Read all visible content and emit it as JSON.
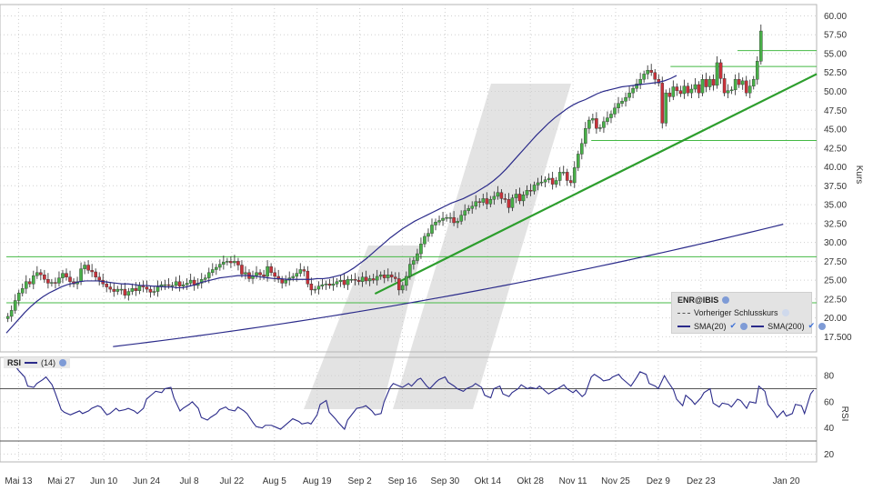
{
  "chart_data": [
    {
      "type": "candlestick",
      "ylabel": "Kurs",
      "ylim": [
        15.5,
        61.5
      ],
      "y_ticks": [
        "60.00",
        "57.50",
        "55.00",
        "52.50",
        "50.00",
        "47.50",
        "45.00",
        "42.50",
        "40.00",
        "37.50",
        "35.00",
        "32.50",
        "30.00",
        "27.50",
        "25.00",
        "22.50",
        "20.00",
        "17.500"
      ],
      "y_tick_values": [
        60,
        57.5,
        55,
        52.5,
        50,
        47.5,
        45,
        42.5,
        40,
        37.5,
        35,
        32.5,
        30,
        27.5,
        25,
        22.5,
        20,
        17.5
      ],
      "x_ticks": [
        "Mai 13",
        "Mai 27",
        "Jun 10",
        "Jun 24",
        "Jul 8",
        "Jul 22",
        "Aug 5",
        "Aug 19",
        "Sep 2",
        "Sep 16",
        "Sep 30",
        "Okt 14",
        "Okt 28",
        "Nov 11",
        "Nov 25",
        "Dez 9",
        "Dez 23",
        "Jan 20"
      ],
      "x_tick_days": [
        4,
        18,
        32,
        46,
        60,
        74,
        88,
        102,
        116,
        130,
        144,
        158,
        172,
        186,
        200,
        214,
        228,
        256
      ],
      "close": [
        20.2,
        21.0,
        22.3,
        23.3,
        23.9,
        24.8,
        24.5,
        25.6,
        26.0,
        25.7,
        25.1,
        24.6,
        24.7,
        24.6,
        25.3,
        25.9,
        25.4,
        24.8,
        24.5,
        24.8,
        26.5,
        27.0,
        26.3,
        26.1,
        25.4,
        25.0,
        24.5,
        24.1,
        23.8,
        23.5,
        23.8,
        23.8,
        23.0,
        23.5,
        23.9,
        23.6,
        24.3,
        24.1,
        23.8,
        23.4,
        23.5,
        24.1,
        24.4,
        24.4,
        24.3,
        24.3,
        24.8,
        24.2,
        24.4,
        24.6,
        25.0,
        24.3,
        24.6,
        25.1,
        25.3,
        26.0,
        26.4,
        26.7,
        27.1,
        27.4,
        27.5,
        27.3,
        27.5,
        27.0,
        25.8,
        26.0,
        25.2,
        25.6,
        26.0,
        25.7,
        25.5,
        26.8,
        26.0,
        25.5,
        25.1,
        24.6,
        25.0,
        25.3,
        25.5,
        25.9,
        26.4,
        26.2,
        24.5,
        23.7,
        23.8,
        24.2,
        24.4,
        24.5,
        24.3,
        24.5,
        24.8,
        25.0,
        24.4,
        25.1,
        25.1,
        25.0,
        24.8,
        25.4,
        24.9,
        25.2,
        25.0,
        25.5,
        25.7,
        25.3,
        25.7,
        25.4,
        25.2,
        23.7,
        24.3,
        25.5,
        27.1,
        27.6,
        28.5,
        29.8,
        30.8,
        31.2,
        32.3,
        32.7,
        32.9,
        33.2,
        33.3,
        33.3,
        32.6,
        32.8,
        33.6,
        34.2,
        34.5,
        34.8,
        35.4,
        35.3,
        35.8,
        35.1,
        35.7,
        36.1,
        36.6,
        35.8,
        35.7,
        34.6,
        35.9,
        36.4,
        35.5,
        36.3,
        36.9,
        36.8,
        37.6,
        37.9,
        38.0,
        38.3,
        38.5,
        37.7,
        38.2,
        39.3,
        39.3,
        38.2,
        37.9,
        39.9,
        41.7,
        43.1,
        45.1,
        46.2,
        46.4,
        45.1,
        45.2,
        46.0,
        46.5,
        47.0,
        47.8,
        48.4,
        48.7,
        49.2,
        49.8,
        50.4,
        51.0,
        51.6,
        52.3,
        52.8,
        52.5,
        51.6,
        51.1,
        45.8,
        49.8,
        49.3,
        50.6,
        50.1,
        49.7,
        50.7,
        49.8,
        50.3,
        50.9,
        49.8,
        51.6,
        50.6,
        51.6,
        50.8,
        53.8,
        51.7,
        49.8,
        50.1,
        50.2,
        51.6,
        50.9,
        51.4,
        49.8,
        50.7,
        51.6,
        54.0,
        58.0
      ],
      "sma20": [
        18.0,
        18.9,
        19.8,
        20.7,
        21.5,
        22.2,
        22.8,
        23.3,
        23.7,
        24.1,
        24.4,
        24.6,
        24.8,
        24.9,
        24.9,
        24.9,
        24.8,
        24.7,
        24.6,
        24.5,
        24.5,
        24.4,
        24.3,
        24.3,
        24.2,
        24.2,
        24.1,
        24.1,
        24.0,
        24.0,
        24.2,
        24.4,
        24.7,
        24.9,
        25.1,
        25.3,
        25.4,
        25.5,
        25.6,
        25.6,
        25.6,
        25.5,
        25.4,
        25.3,
        25.2,
        25.2,
        25.1,
        25.1,
        25.1,
        25.1,
        25.1,
        25.2,
        25.2,
        25.3,
        25.5,
        25.7,
        26.1,
        26.6,
        27.2,
        27.8,
        28.5,
        29.2,
        29.9,
        30.6,
        31.2,
        31.8,
        32.3,
        32.8,
        33.2,
        33.6,
        34.0,
        34.4,
        34.8,
        35.2,
        35.5,
        35.8,
        36.2,
        36.6,
        37.1,
        37.6,
        38.2,
        38.9,
        39.7,
        40.6,
        41.5,
        42.4,
        43.3,
        44.2,
        45.0,
        45.8,
        46.5,
        47.1,
        47.7,
        48.2,
        48.6,
        48.9,
        49.3,
        49.7,
        50.0,
        50.2,
        50.4,
        50.6,
        50.7,
        50.8,
        50.9,
        51.0,
        51.1,
        51.2,
        51.4,
        51.7,
        52.1
      ],
      "sma20_days": [
        0,
        2,
        4,
        6,
        8,
        10,
        12,
        14,
        16,
        18,
        20,
        22,
        24,
        26,
        28,
        30,
        32,
        34,
        36,
        38,
        40,
        42,
        44,
        46,
        48,
        50,
        52,
        54,
        56,
        58,
        60,
        62,
        64,
        66,
        68,
        70,
        72,
        74,
        76,
        78,
        80,
        82,
        84,
        86,
        88,
        90,
        92,
        94,
        96,
        98,
        100,
        102,
        104,
        106,
        108,
        110,
        112,
        114,
        116,
        118,
        120,
        122,
        124,
        126,
        128,
        130,
        132,
        134,
        136,
        138,
        140,
        142,
        144,
        146,
        148,
        150,
        152,
        154,
        156,
        158,
        160,
        162,
        164,
        166,
        168,
        170,
        172,
        174,
        176,
        178,
        180,
        182,
        184,
        186,
        188,
        190,
        192,
        194,
        196,
        198,
        200,
        202,
        204,
        206,
        208,
        210,
        212,
        214,
        216,
        218,
        220
      ],
      "sma200": {
        "start_day": 35,
        "end_day": 258,
        "start": 16.2,
        "end": 32.7
      },
      "lines": [
        {
          "kind": "support",
          "value": 28.1,
          "color": "#44b944"
        },
        {
          "kind": "support",
          "value": 22.0,
          "color": "#44b944"
        },
        {
          "kind": "support",
          "value": 43.5,
          "color": "#44b944"
        },
        {
          "kind": "resistance",
          "value": 53.3,
          "color": "#44b944"
        },
        {
          "kind": "resistance",
          "value": 55.4,
          "color": "#44b944"
        },
        {
          "kind": "trend",
          "from": [
            121,
            23.2
          ],
          "to": [
            266,
            52.3
          ],
          "color": "#2d9e2d"
        }
      ],
      "legend": {
        "symbol": "ENR@IBIS",
        "items": [
          "Vorheriger Schlusskurs",
          "SMA(20)",
          "SMA(200)"
        ]
      }
    },
    {
      "type": "line",
      "title": "RSI",
      "period_label": "(14)",
      "ylabel": "RSI",
      "ylim": [
        14,
        94
      ],
      "y_ticks": [
        "80",
        "60",
        "40",
        "20"
      ],
      "y_tick_values": [
        80,
        60,
        40,
        20
      ],
      "bands": [
        70,
        30
      ],
      "values": [
        88,
        90,
        87,
        84,
        79,
        72,
        71,
        74,
        77,
        79,
        73,
        67,
        54,
        52,
        50,
        51,
        53,
        51,
        53,
        55,
        57,
        56,
        50,
        51,
        55,
        53,
        54,
        55,
        53,
        51,
        55,
        62,
        66,
        68,
        67,
        70,
        71,
        63,
        53,
        55,
        58,
        60,
        55,
        48,
        46,
        48,
        51,
        54,
        56,
        54,
        53,
        56,
        53,
        51,
        44,
        41,
        40,
        42,
        42,
        41,
        39,
        41,
        45,
        47,
        45,
        43,
        44,
        43,
        50,
        58,
        61,
        52,
        47,
        44,
        39,
        46,
        52,
        55,
        56,
        57,
        53,
        50,
        51,
        60,
        71,
        74,
        72,
        71,
        74,
        72,
        77,
        78,
        72,
        70,
        75,
        77,
        79,
        75,
        72,
        70,
        68,
        70,
        72,
        74,
        71,
        65,
        63,
        70,
        72,
        66,
        64,
        67,
        70,
        73,
        70,
        71,
        70,
        72,
        68,
        66,
        69,
        70,
        73,
        70,
        67,
        69,
        64,
        66,
        79,
        81,
        78,
        76,
        77,
        79,
        81,
        78,
        74,
        72,
        79,
        83,
        81,
        74,
        72,
        70,
        80,
        76,
        69,
        62,
        57,
        65,
        61,
        58,
        63,
        67,
        70,
        59,
        56,
        59,
        58,
        56,
        62,
        61,
        55,
        60,
        59,
        72,
        68,
        58,
        52,
        48,
        53,
        49,
        51,
        58,
        57,
        51,
        66,
        69
      ],
      "values_days": [
        0,
        1,
        3,
        4,
        6,
        7,
        9,
        10,
        12,
        13,
        15,
        16,
        18,
        19,
        21,
        22,
        24,
        25,
        27,
        28,
        30,
        31,
        33,
        34,
        36,
        37,
        39,
        40,
        42,
        43,
        45,
        46,
        48,
        49,
        51,
        52,
        54,
        55,
        57,
        58,
        60,
        61,
        63,
        64,
        66,
        67,
        69,
        70,
        72,
        73,
        75,
        76,
        78,
        79,
        81,
        82,
        84,
        85,
        87,
        88,
        90,
        91,
        93,
        94,
        96,
        97,
        99,
        100,
        102,
        103,
        105,
        106,
        108,
        109,
        111,
        112,
        114,
        115,
        117,
        118,
        120,
        121,
        123,
        124,
        126,
        127,
        129,
        130,
        132,
        133,
        135,
        136,
        138,
        139,
        141,
        142,
        144,
        145,
        147,
        148,
        150,
        151,
        153,
        154,
        156,
        157,
        159,
        160,
        162,
        163,
        165,
        166,
        168,
        169,
        171,
        172,
        174,
        175,
        177,
        178,
        180,
        181,
        183,
        184,
        186,
        187,
        189,
        190,
        192,
        193,
        195,
        196,
        198,
        199,
        201,
        202,
        204,
        205,
        207,
        208,
        210,
        211,
        213,
        214,
        216,
        217,
        219,
        220,
        222,
        223,
        225,
        226,
        228,
        229,
        231,
        232,
        234,
        235,
        237,
        238,
        240,
        241,
        243,
        244,
        246,
        247,
        249,
        250,
        252,
        253,
        255,
        256,
        258,
        259,
        261,
        262,
        264,
        265,
        267,
        268
      ]
    }
  ],
  "colors": {
    "up": "#48b048",
    "down": "#c8323a",
    "wick": "#222222",
    "sma": "#2b2b8a",
    "grid": "#d0d0d0",
    "band": "#555555",
    "watermark": "#dcdcdc"
  }
}
